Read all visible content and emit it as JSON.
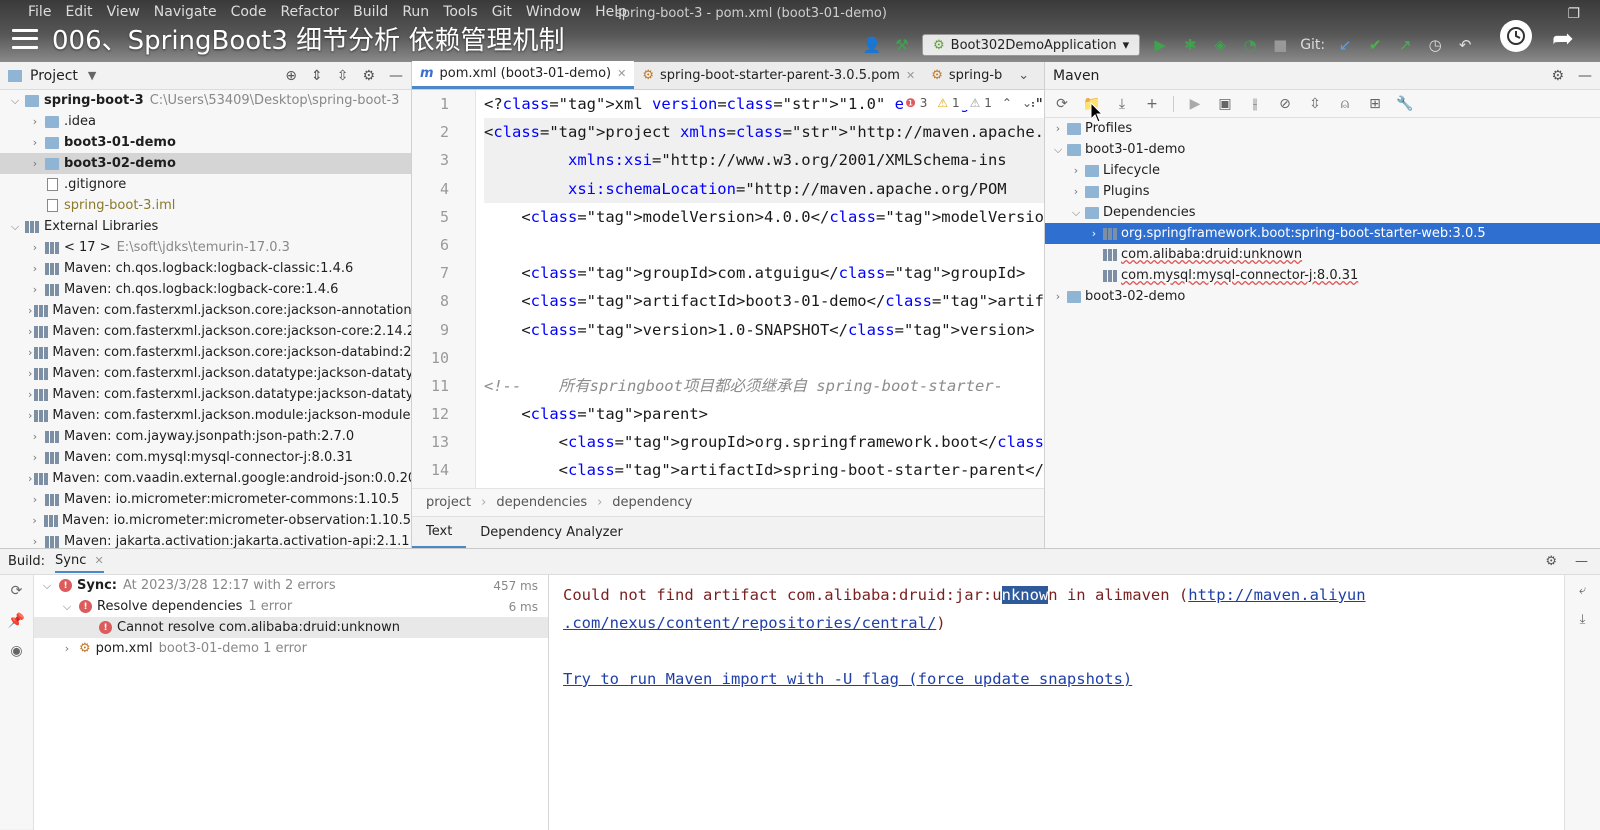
{
  "window": {
    "menu": [
      "File",
      "Edit",
      "View",
      "Navigate",
      "Code",
      "Refactor",
      "Build",
      "Run",
      "Tools",
      "Git",
      "Window",
      "Help"
    ],
    "title": "spring-boot-3 - pom.xml (boot3-01-demo)",
    "video_title": "006、SpringBoot3 细节分析 依赖管理机制",
    "run_config": "Boot302DemoApplication",
    "git_label": "Git:"
  },
  "project": {
    "header": "Project",
    "items": [
      {
        "label": "spring-boot-3",
        "path": "C:\\Users\\53409\\Desktop\\spring-boot-3",
        "indent": 0,
        "arrow": "⌵",
        "bold": true
      },
      {
        "label": ".idea",
        "path": "",
        "indent": 1,
        "arrow": "›",
        "bold": false
      },
      {
        "label": "boot3-01-demo",
        "path": "",
        "indent": 1,
        "arrow": "›",
        "bold": true
      },
      {
        "label": "boot3-02-demo",
        "path": "",
        "indent": 1,
        "arrow": "›",
        "bold": true
      },
      {
        "label": ".gitignore",
        "path": "",
        "indent": 1,
        "arrow": "",
        "bold": false
      },
      {
        "label": "spring-boot-3.iml",
        "path": "",
        "indent": 1,
        "arrow": "",
        "bold": false
      },
      {
        "label": "External Libraries",
        "path": "",
        "indent": 0,
        "arrow": "⌵",
        "bold": false
      },
      {
        "label": "< 17 >",
        "path": "E:\\soft\\jdks\\temurin-17.0.3",
        "indent": 1,
        "arrow": "›",
        "bold": false
      },
      {
        "label": "Maven: ch.qos.logback:logback-classic:1.4.6",
        "path": "",
        "indent": 1,
        "arrow": "›",
        "bold": false
      },
      {
        "label": "Maven: ch.qos.logback:logback-core:1.4.6",
        "path": "",
        "indent": 1,
        "arrow": "›",
        "bold": false
      },
      {
        "label": "Maven: com.fasterxml.jackson.core:jackson-annotations",
        "path": "",
        "indent": 1,
        "arrow": "›",
        "bold": false
      },
      {
        "label": "Maven: com.fasterxml.jackson.core:jackson-core:2.14.2",
        "path": "",
        "indent": 1,
        "arrow": "›",
        "bold": false
      },
      {
        "label": "Maven: com.fasterxml.jackson.core:jackson-databind:2.1",
        "path": "",
        "indent": 1,
        "arrow": "›",
        "bold": false
      },
      {
        "label": "Maven: com.fasterxml.jackson.datatype:jackson-datatyp",
        "path": "",
        "indent": 1,
        "arrow": "›",
        "bold": false
      },
      {
        "label": "Maven: com.fasterxml.jackson.datatype:jackson-datatyp",
        "path": "",
        "indent": 1,
        "arrow": "›",
        "bold": false
      },
      {
        "label": "Maven: com.fasterxml.jackson.module:jackson-module-",
        "path": "",
        "indent": 1,
        "arrow": "›",
        "bold": false
      },
      {
        "label": "Maven: com.jayway.jsonpath:json-path:2.7.0",
        "path": "",
        "indent": 1,
        "arrow": "›",
        "bold": false
      },
      {
        "label": "Maven: com.mysql:mysql-connector-j:8.0.31",
        "path": "",
        "indent": 1,
        "arrow": "›",
        "bold": false
      },
      {
        "label": "Maven: com.vaadin.external.google:android-json:0.0.20",
        "path": "",
        "indent": 1,
        "arrow": "›",
        "bold": false
      },
      {
        "label": "Maven: io.micrometer:micrometer-commons:1.10.5",
        "path": "",
        "indent": 1,
        "arrow": "›",
        "bold": false
      },
      {
        "label": "Maven: io.micrometer:micrometer-observation:1.10.5",
        "path": "",
        "indent": 1,
        "arrow": "›",
        "bold": false
      },
      {
        "label": "Maven: jakarta.activation:jakarta.activation-api:2.1.1",
        "path": "",
        "indent": 1,
        "arrow": "›",
        "bold": false
      }
    ]
  },
  "editor": {
    "tabs": [
      {
        "label": "pom.xml (boot3-01-demo)",
        "active": true
      },
      {
        "label": "spring-boot-starter-parent-3.0.5.pom",
        "active": false
      },
      {
        "label": "spring-b",
        "active": false
      }
    ],
    "status": {
      "errors": "3",
      "warnings": "1",
      "weak": "1"
    },
    "line_numbers": [
      "1",
      "2",
      "3",
      "4",
      "5",
      "6",
      "7",
      "8",
      "9",
      "10",
      "11",
      "12",
      "13",
      "14"
    ],
    "lines": [
      "<?xml version=\"1.0\" encoding=\"UTF-8\"?>",
      "<project xmlns=\"http://maven.apache.org/POM/4.0.0\"",
      "         xmlns:xsi=\"http://www.w3.org/2001/XMLSchema-ins",
      "         xsi:schemaLocation=\"http://maven.apache.org/POM",
      "    <modelVersion>4.0.0</modelVersion>",
      "",
      "    <groupId>com.atguigu</groupId>",
      "    <artifactId>boot3-01-demo</artifactId>",
      "    <version>1.0-SNAPSHOT</version>",
      "",
      "<!--    所有springboot项目都必须继承自 spring-boot-starter-",
      "    <parent>",
      "        <groupId>org.springframework.boot</groupId>",
      "        <artifactId>spring-boot-starter-parent</artifact"
    ],
    "breadcrumb": [
      "project",
      "dependencies",
      "dependency"
    ],
    "bottom_tabs": [
      "Text",
      "Dependency Analyzer"
    ]
  },
  "maven": {
    "header": "Maven",
    "items": [
      {
        "label": "Profiles",
        "indent": 0,
        "arrow": "›",
        "selected": false
      },
      {
        "label": "boot3-01-demo",
        "indent": 0,
        "arrow": "⌵",
        "selected": false
      },
      {
        "label": "Lifecycle",
        "indent": 1,
        "arrow": "›",
        "selected": false
      },
      {
        "label": "Plugins",
        "indent": 1,
        "arrow": "›",
        "selected": false
      },
      {
        "label": "Dependencies",
        "indent": 1,
        "arrow": "⌵",
        "selected": false
      },
      {
        "label": "org.springframework.boot:spring-boot-starter-web:3.0.5",
        "indent": 2,
        "arrow": "›",
        "selected": true
      },
      {
        "label": "com.alibaba:druid:unknown",
        "indent": 2,
        "arrow": "",
        "selected": false
      },
      {
        "label": "com.mysql:mysql-connector-j:8.0.31",
        "indent": 2,
        "arrow": "",
        "selected": false
      },
      {
        "label": "boot3-02-demo",
        "indent": 0,
        "arrow": "›",
        "selected": false
      }
    ]
  },
  "build": {
    "label": "Build:",
    "tab": "Sync",
    "tree": [
      {
        "label": "Sync:",
        "detail": "At 2023/3/28 12:17 with 2 errors",
        "time": "457 ms",
        "indent": 0
      },
      {
        "label": "Resolve dependencies",
        "detail": "1 error",
        "time": "6 ms",
        "indent": 1
      },
      {
        "label": "Cannot resolve com.alibaba:druid:unknown",
        "detail": "",
        "time": "",
        "indent": 2
      },
      {
        "label": "pom.xml",
        "detail": "boot3-01-demo 1 error",
        "time": "",
        "indent": 1
      }
    ],
    "output": {
      "line1_pre": "Could not find artifact com.alibaba:druid:jar:u",
      "line1_sel": "nknow",
      "line1_post": "n in alimaven (",
      "line1_link": "http://maven.aliyun",
      "line2_link": ".com/nexus/content/repositories/central/",
      "line2_post": ")",
      "line3_link": "Try to run Maven import with -U flag (force update snapshots)"
    }
  }
}
